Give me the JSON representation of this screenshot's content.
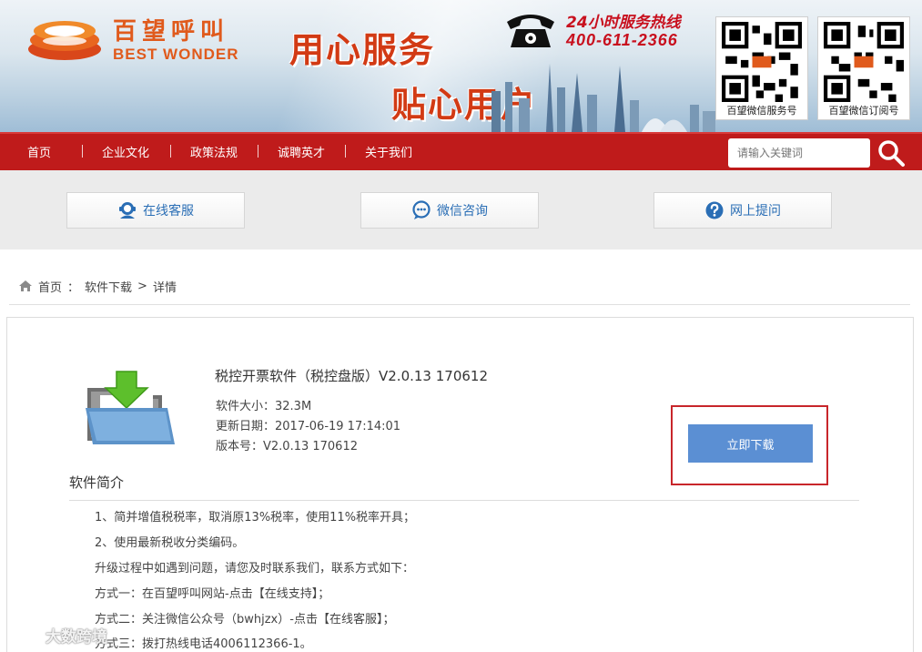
{
  "banner": {
    "brand_cn": "百望呼叫",
    "brand_en": "BEST WONDER",
    "slogan_line1": "用心服务",
    "slogan_line2": "贴心用户",
    "hotline_label": "24小时服务热线",
    "hotline_number": "400-611-2366",
    "qr_codes": [
      {
        "caption": "百望微信服务号"
      },
      {
        "caption": "百望微信订阅号"
      }
    ],
    "colors": {
      "brand": "#e05a1c",
      "slogan": "#d23a14",
      "hotline": "#c8101e"
    }
  },
  "nav": {
    "items": [
      {
        "label": "首页"
      },
      {
        "label": "企业文化"
      },
      {
        "label": "政策法规"
      },
      {
        "label": "诚聘英才"
      },
      {
        "label": "关于我们"
      }
    ],
    "search_placeholder": "请输入关键词",
    "search_icon": "magnifier-icon",
    "color": "#bf1b1b"
  },
  "services": [
    {
      "label": "在线客服",
      "icon": "customer-service-icon"
    },
    {
      "label": "微信咨询",
      "icon": "chat-bubble-icon"
    },
    {
      "label": "网上提问",
      "icon": "question-icon"
    }
  ],
  "breadcrumb": {
    "home": "首页",
    "sep1": "：",
    "section": "软件下载",
    "sep2": ">",
    "current": "详情"
  },
  "software": {
    "title": "税控开票软件（税控盘版）V2.0.13 170612",
    "size": "软件大小：32.3M",
    "updated": "更新日期：2017-06-19 17:14:01",
    "version": "版本号：V2.0.13 170612",
    "download_label": "立即下载",
    "download_color": "#5b8fd3"
  },
  "intro": {
    "title": "软件简介",
    "lines": [
      "1、简并增值税税率，取消原13%税率，使用11%税率开具；",
      "2、使用最新税收分类编码。",
      "升级过程中如遇到问题，请您及时联系我们，联系方式如下：",
      "方式一：在百望呼叫网站-点击【在线支持】；",
      "方式二：关注微信公众号（bwhjzx）-点击【在线客服】；",
      "方式三：拨打热线电话4006112366-1。"
    ]
  },
  "watermark": {
    "text": "大数跨境"
  }
}
